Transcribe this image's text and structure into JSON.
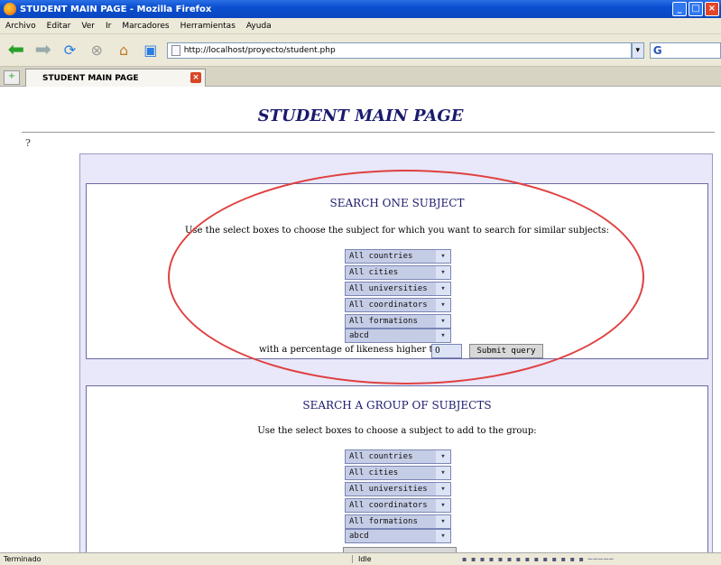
{
  "window": {
    "title": "STUDENT MAIN PAGE - Mozilla Firefox"
  },
  "menu": [
    "Archivo",
    "Editar",
    "Ver",
    "Ir",
    "Marcadores",
    "Herramientas",
    "Ayuda"
  ],
  "nav": {
    "url": "http://localhost/proyecto/student.php",
    "search_glyph": "G"
  },
  "tab": {
    "label": "STUDENT MAIN PAGE"
  },
  "page": {
    "title": "STUDENT MAIN PAGE",
    "help_glyph": "?"
  },
  "search_one": {
    "title": "SEARCH ONE SUBJECT",
    "description": "Use the select boxes to choose the subject for which you want to search for similar subjects:",
    "selects": [
      "All countries",
      "All cities",
      "All universities",
      "All coordinators",
      "All formations",
      "abcd"
    ],
    "likeness_label": "with a percentage of likeness higher than:",
    "likeness_value": "0",
    "submit_label": "Submit query"
  },
  "search_group": {
    "title": "SEARCH A GROUP OF SUBJECTS",
    "description": "Use the select boxes to choose a subject to add to the group:",
    "selects": [
      "All countries",
      "All cities",
      "All universities",
      "All coordinators",
      "All formations",
      "abcd"
    ]
  },
  "status": {
    "left": "Terminado",
    "mid": "Idle"
  },
  "colors": {
    "accent_title": "#1a1a6e",
    "highlight_ellipse": "#e04040",
    "select_bg": "#c5cde6"
  }
}
